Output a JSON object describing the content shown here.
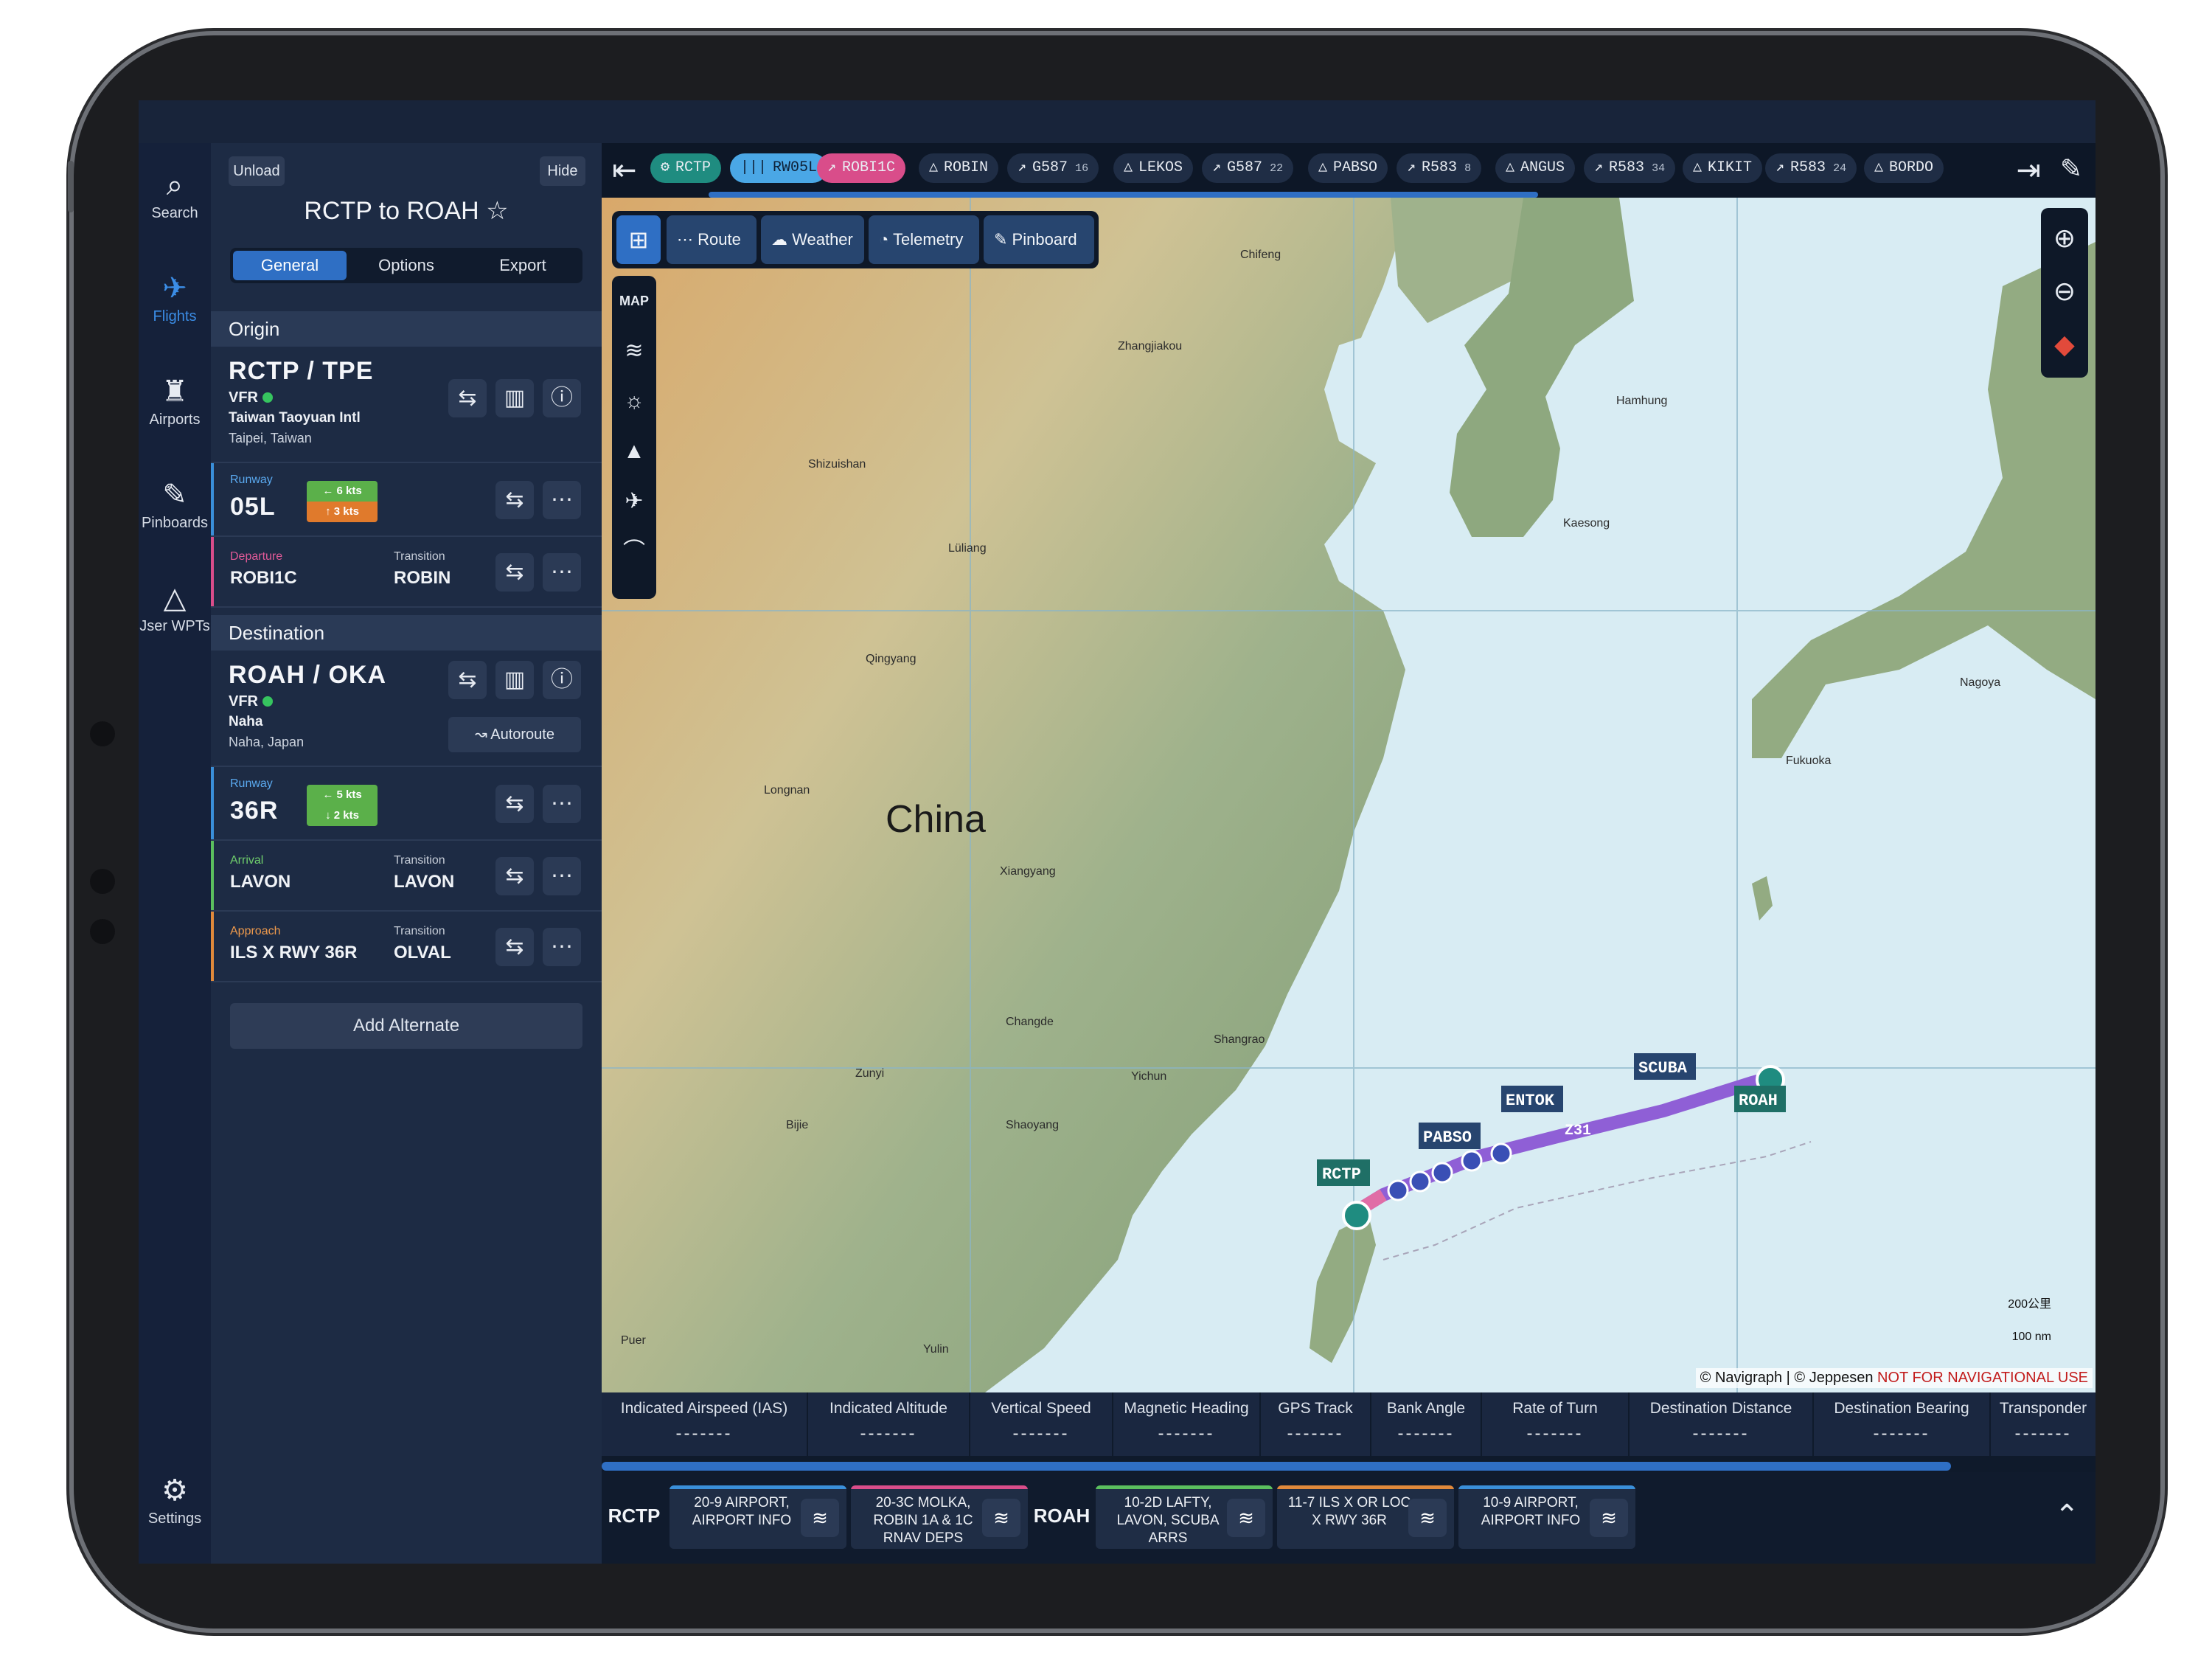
{
  "rail": {
    "items": [
      {
        "label": "Search",
        "icon": "⌕"
      },
      {
        "label": "Flights",
        "icon": "✈"
      },
      {
        "label": "Airports",
        "icon": "♜"
      },
      {
        "label": "Pinboards",
        "icon": "✎"
      },
      {
        "label": "Jser WPTs",
        "icon": "△"
      }
    ],
    "settings": {
      "label": "Settings",
      "icon": "⚙"
    }
  },
  "panel": {
    "unload": "Unload",
    "hide": "Hide",
    "title": "RCTP to ROAH ☆",
    "tabs": [
      "General",
      "Options",
      "Export"
    ],
    "origin": {
      "section": "Origin",
      "code": "RCTP / TPE",
      "rules": "VFR",
      "name": "Taiwan Taoyuan Intl",
      "city": "Taipei, Taiwan",
      "runway_label": "Runway",
      "runway": "05L",
      "wind_head": "← 6 kts",
      "wind_cross": "↑ 3 kts",
      "departure_label": "Departure",
      "departure": "ROBI1C",
      "transition_label": "Transition",
      "transition": "ROBIN"
    },
    "destination": {
      "section": "Destination",
      "code": "ROAH / OKA",
      "rules": "VFR",
      "name": "Naha",
      "city": "Naha, Japan",
      "autoroute": "Autoroute",
      "runway_label": "Runway",
      "runway": "36R",
      "wind_head": "← 5 kts",
      "wind_cross": "↓ 2 kts",
      "arrival_label": "Arrival",
      "arrival": "LAVON",
      "arr_transition_label": "Transition",
      "arr_transition": "LAVON",
      "approach_label": "Approach",
      "approach": "ILS X RWY 36R",
      "app_transition_label": "Transition",
      "app_transition": "OLVAL"
    },
    "add_alternate": "Add Alternate"
  },
  "waypoints": [
    {
      "label": "RCTP",
      "icon": "⚙",
      "style": "teal"
    },
    {
      "label": "RW05L",
      "icon": "|||",
      "style": "blue"
    },
    {
      "label": "ROBI1C",
      "icon": "↗",
      "style": "pink"
    },
    {
      "label": "ROBIN",
      "icon": "△",
      "style": ""
    },
    {
      "label": "G587",
      "icon": "↗",
      "num": "16",
      "style": ""
    },
    {
      "label": "LEKOS",
      "icon": "△",
      "style": ""
    },
    {
      "label": "G587",
      "icon": "↗",
      "num": "22",
      "style": ""
    },
    {
      "label": "PABSO",
      "icon": "△",
      "style": ""
    },
    {
      "label": "R583",
      "icon": "↗",
      "num": "8",
      "style": ""
    },
    {
      "label": "ANGUS",
      "icon": "△",
      "style": ""
    },
    {
      "label": "R583",
      "icon": "↗",
      "num": "34",
      "style": ""
    },
    {
      "label": "KIKIT",
      "icon": "△",
      "style": ""
    },
    {
      "label": "R583",
      "icon": "↗",
      "num": "24",
      "style": ""
    },
    {
      "label": "BORDO",
      "icon": "△",
      "style": ""
    }
  ],
  "map": {
    "toolbar": [
      "Route",
      "Weather",
      "Telemetry",
      "Pinboard"
    ],
    "map_label": "MAP",
    "country": "China",
    "cities": [
      "Chifeng",
      "Zhangjiakou",
      "Shizuishan",
      "Lüliang",
      "Qingyang",
      "Hamhung",
      "Kaesong",
      "Longnan",
      "Xiangyang",
      "Changde",
      "Zunyi",
      "Bijie",
      "Shaoyang",
      "Yichun",
      "Shangrao",
      "Fukuoka",
      "Nagoya",
      "Puer",
      "Yulin"
    ],
    "route_labels": [
      "RCTP",
      "PABSO",
      "ENTOK",
      "SCUBA",
      "ROAH",
      "Z31"
    ],
    "scale_km": "200公里",
    "scale_nm": "100 nm",
    "copyright": "© Navigraph | © Jeppesen",
    "warning": "NOT FOR NAVIGATIONAL USE"
  },
  "telemetry": [
    {
      "label": "Indicated Airspeed (IAS)",
      "value": "-------"
    },
    {
      "label": "Indicated Altitude",
      "value": "-------"
    },
    {
      "label": "Vertical Speed",
      "value": "-------"
    },
    {
      "label": "Magnetic Heading",
      "value": "-------"
    },
    {
      "label": "GPS Track",
      "value": "-------"
    },
    {
      "label": "Bank Angle",
      "value": "-------"
    },
    {
      "label": "Rate of Turn",
      "value": "-------"
    },
    {
      "label": "Destination Distance",
      "value": "-------"
    },
    {
      "label": "Destination Bearing",
      "value": "-------"
    },
    {
      "label": "Transponder",
      "value": "-------"
    }
  ],
  "tray": {
    "origin": "RCTP",
    "destination": "ROAH",
    "cards": [
      {
        "text": "20-9 AIRPORT, AIRPORT INFO",
        "color": "#3a8fd9"
      },
      {
        "text": "20-3C MOLKA, ROBIN 1A & 1C RNAV DEPS",
        "color": "#d94d8a"
      },
      {
        "text": "10-2D LAFTY, LAVON, SCUBA ARRS",
        "color": "#5bbf5e"
      },
      {
        "text": "11-7 ILS X OR LOC X RWY 36R",
        "color": "#e0893b"
      },
      {
        "text": "10-9 AIRPORT, AIRPORT INFO",
        "color": "#3a8fd9"
      }
    ]
  }
}
